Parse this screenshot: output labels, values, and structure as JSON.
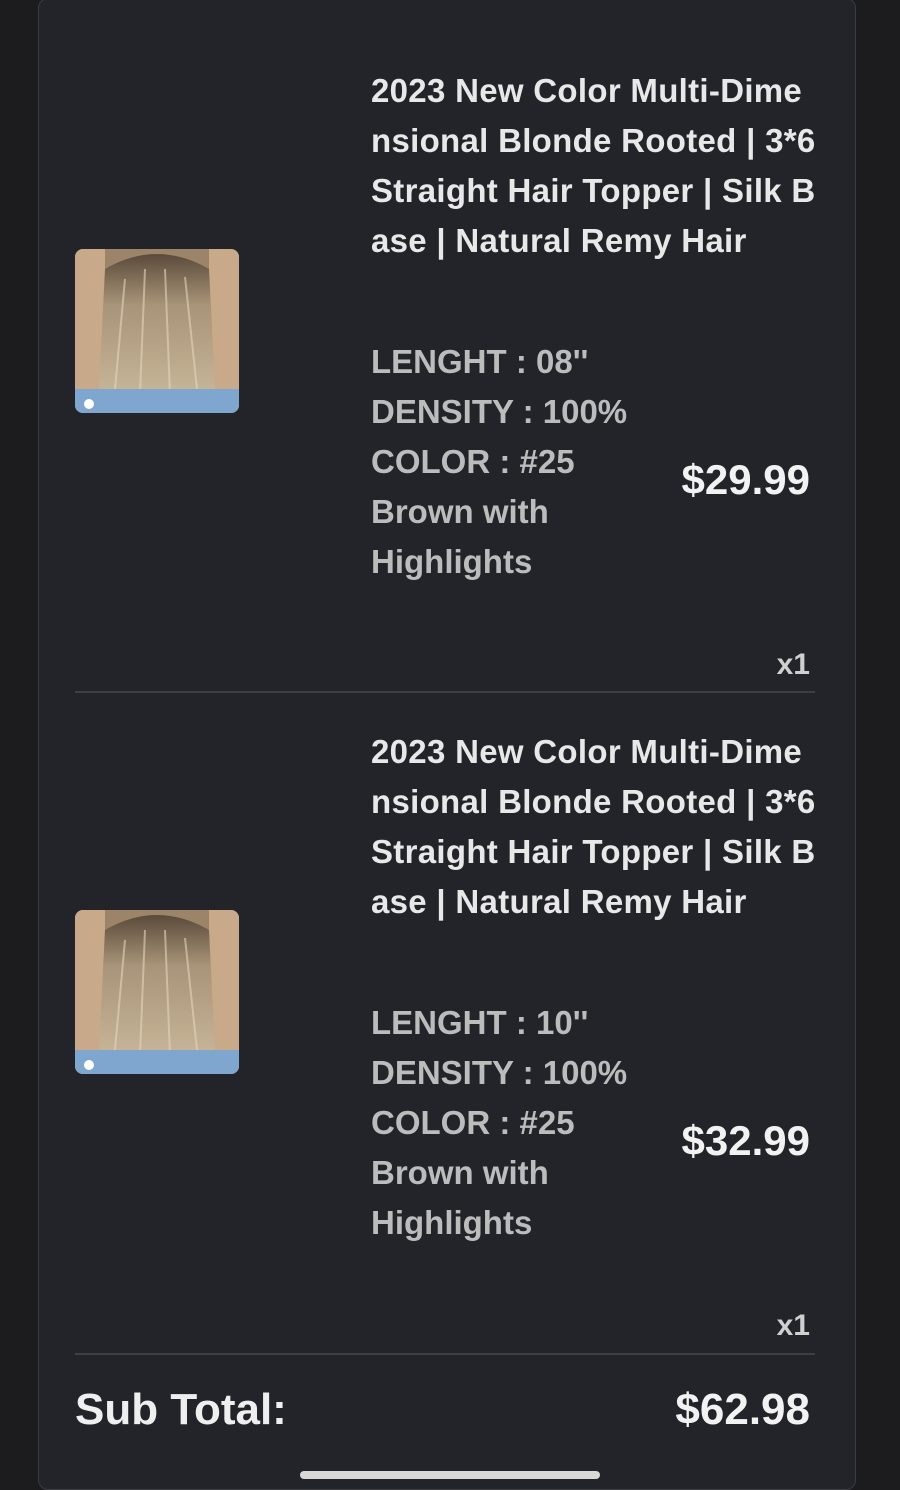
{
  "cart": {
    "items": [
      {
        "image_icon": "hair-topper-photo",
        "title": "2023 New Color Multi-Dimensional Blonde Rooted | 3*6 Straight Hair Topper | Silk Base | Natural Remy Hair",
        "length_label": "LENGHT : 08''",
        "density_label": "DENSITY : 100%",
        "color_label": "COLOR : #25 Brown with Highlights",
        "price": "$29.99",
        "quantity": "x1"
      },
      {
        "image_icon": "hair-topper-photo",
        "title": "2023 New Color Multi-Dimensional Blonde Rooted | 3*6 Straight Hair Topper | Silk Base | Natural Remy Hair",
        "length_label": "LENGHT : 10''",
        "density_label": "DENSITY : 100%",
        "color_label": "COLOR : #25 Brown with Highlights",
        "price": "$32.99",
        "quantity": "x1"
      }
    ],
    "subtotal_label": "Sub Total:",
    "subtotal_value": "$62.98"
  },
  "colors": {
    "background": "#1c1c1f",
    "panel": "#23242a",
    "text_primary": "#e8e8e8",
    "text_secondary": "#bcbcbc"
  }
}
